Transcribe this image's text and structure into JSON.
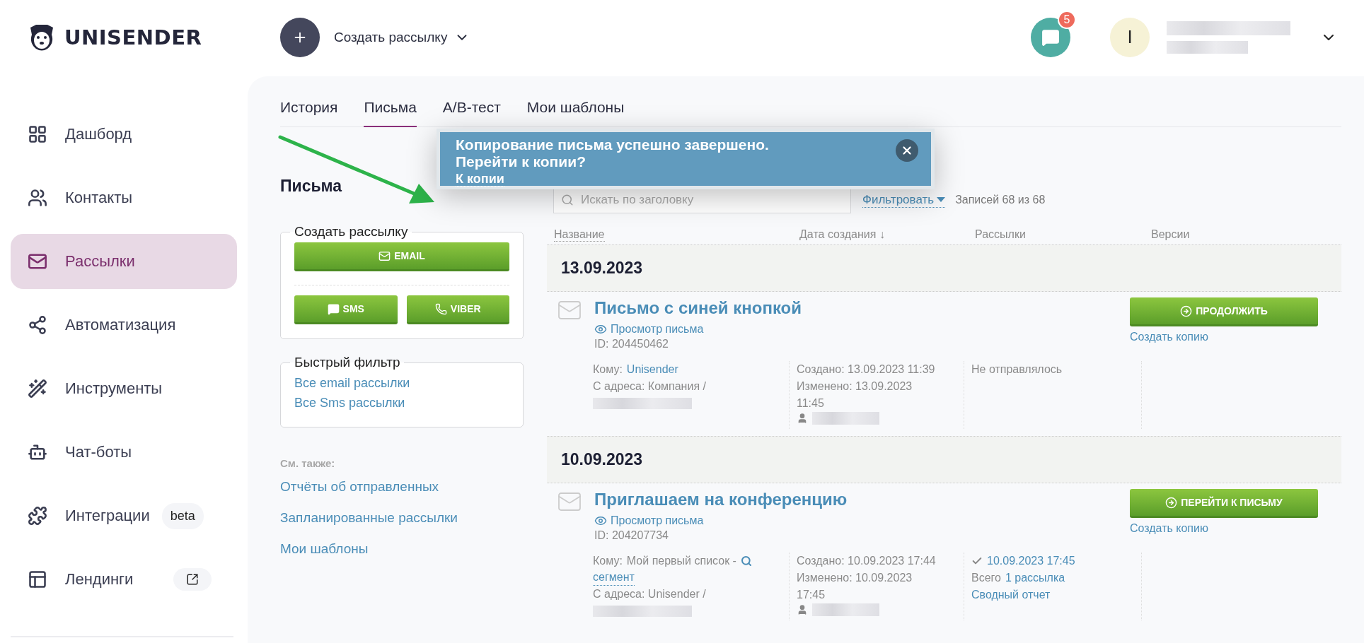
{
  "header": {
    "logo_text": "UNISENDER",
    "create_label": "Создать рассылку",
    "notifications_count": "5",
    "avatar_initial": "I"
  },
  "sidebar": {
    "items": [
      {
        "label": "Дашборд",
        "selected": false,
        "external_link": false
      },
      {
        "label": "Контакты",
        "selected": false,
        "external_link": false
      },
      {
        "label": "Рассылки",
        "selected": true,
        "external_link": false
      },
      {
        "label": "Автоматизация",
        "selected": false,
        "external_link": false
      },
      {
        "label": "Инструменты",
        "selected": false,
        "external_link": false
      },
      {
        "label": "Чат-боты",
        "selected": false,
        "external_link": false
      },
      {
        "label": "Интеграции",
        "selected": false,
        "external_link": false,
        "badge": "beta"
      },
      {
        "label": "Лендинги",
        "selected": false,
        "external_link": true
      }
    ]
  },
  "tabs": [
    {
      "label": "История",
      "selected": false
    },
    {
      "label": "Письма",
      "selected": true
    },
    {
      "label": "A/B-тест",
      "selected": false
    },
    {
      "label": "Мои шаблоны",
      "selected": false
    }
  ],
  "left": {
    "title": "Письма",
    "create_box": {
      "legend": "Создать рассылку",
      "buttons": [
        {
          "label": "EMAIL"
        },
        {
          "label": "SMS"
        },
        {
          "label": "VIBER"
        }
      ]
    },
    "quick_filter": {
      "legend": "Быстрый фильтр",
      "links": [
        "Все email рассылки",
        "Все Sms рассылки"
      ]
    },
    "see_also": {
      "title": "См. также:",
      "links": [
        "Отчёты об отправленных",
        "Запланированные рассылки",
        "Мои шаблоны"
      ]
    }
  },
  "toolbar": {
    "search_placeholder": "Искать по заголовку",
    "filter_label": "Фильтровать",
    "count": "Записей 68 из 68"
  },
  "table": {
    "columns": [
      "Название",
      "Дата создания ↓",
      "Рассылки",
      "Версии"
    ],
    "groups": [
      {
        "date": "13.09.2023",
        "rows": [
          {
            "title": "Письмо с синей кнопкой",
            "preview_link": "Просмотр письма",
            "id": "ID: 204450462",
            "to": {
              "label": "Кому:",
              "value": "Unisender",
              "value_is_link": true
            },
            "from": "С адреса: Компания /",
            "created": "Создано: 13.09.2023 11:39",
            "modified": "Изменено: 13.09.2023 11:45",
            "status": {
              "kind": "not_sent",
              "text": "Не отправлялось"
            },
            "action": "ПРОДОЛЖИТЬ",
            "copy_link": "Создать копию"
          }
        ]
      },
      {
        "date": "10.09.2023",
        "rows": [
          {
            "title": "Приглашаем на конференцию",
            "preview_link": "Просмотр письма",
            "id": "ID: 204207734",
            "to": {
              "label": "Кому:",
              "value": "Мой первый список -",
              "value_is_link": false,
              "segment_link": "сегмент"
            },
            "from": "С адреса: Unisender /",
            "created": "Создано: 10.09.2023 17:44",
            "modified": "Изменено: 10.09.2023 17:45",
            "status": {
              "kind": "sent",
              "sent_at": "10.09.2023 17:45",
              "total_label": "Всего",
              "total_link": "1 рассылка",
              "report_link": "Сводный отчет"
            },
            "action": "ПЕРЕЙТИ К ПИСЬМУ",
            "copy_link": "Создать копию"
          }
        ]
      }
    ]
  },
  "popup": {
    "message": "Копирование письма успешно завершено. Перейти к копии?",
    "link": "К копии"
  }
}
